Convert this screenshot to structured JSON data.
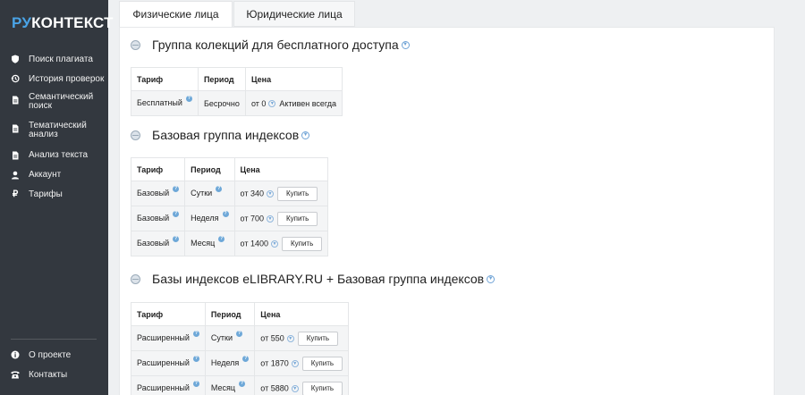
{
  "logo": {
    "part1": "РУ",
    "part2": "КОНТЕКСТ"
  },
  "nav": [
    {
      "label": "Поиск плагиата",
      "icon": "shield-icon"
    },
    {
      "label": "История проверок",
      "icon": "history-icon"
    },
    {
      "label": "Семантический поиск",
      "icon": "document-icon"
    },
    {
      "label": "Тематический анализ",
      "icon": "document-icon"
    },
    {
      "label": "Анализ текста",
      "icon": "document-icon"
    },
    {
      "label": "Аккаунт",
      "icon": "user-icon"
    },
    {
      "label": "Тарифы",
      "icon": "ruble-icon"
    }
  ],
  "nav_bottom": [
    {
      "label": "О проекте",
      "icon": "info-icon"
    },
    {
      "label": "Контакты",
      "icon": "phone-icon"
    }
  ],
  "tabs": [
    {
      "label": "Физические лица",
      "active": true
    },
    {
      "label": "Юридические лица",
      "active": false
    }
  ],
  "headers": {
    "tariff": "Тариф",
    "period": "Период",
    "price": "Цена"
  },
  "sections": [
    {
      "title": "Группа колекций для бесплатного доступа",
      "rows": [
        {
          "tariff": "Бесплатный",
          "period": "Бесрочно",
          "price": "от 0",
          "extra": "Активен всегда"
        }
      ]
    },
    {
      "title": "Базовая группа индексов",
      "rows": [
        {
          "tariff": "Базовый",
          "period": "Сутки",
          "price": "от 340",
          "button": "Купить"
        },
        {
          "tariff": "Базовый",
          "period": "Неделя",
          "price": "от 700",
          "button": "Купить"
        },
        {
          "tariff": "Базовый",
          "period": "Месяц",
          "price": "от 1400",
          "button": "Купить"
        }
      ]
    },
    {
      "title": "Базы индексов eLIBRARY.RU + Базовая группа индексов",
      "rows": [
        {
          "tariff": "Расширенный",
          "period": "Сутки",
          "price": "от 550",
          "button": "Купить"
        },
        {
          "tariff": "Расширенный",
          "period": "Неделя",
          "price": "от 1870",
          "button": "Купить"
        },
        {
          "tariff": "Расширенный",
          "period": "Месяц",
          "price": "от 5880",
          "button": "Купить"
        }
      ]
    }
  ],
  "colors": {
    "sidebar": "#33383f",
    "accent": "#4aa3e6",
    "help": "#6ea8d8"
  }
}
